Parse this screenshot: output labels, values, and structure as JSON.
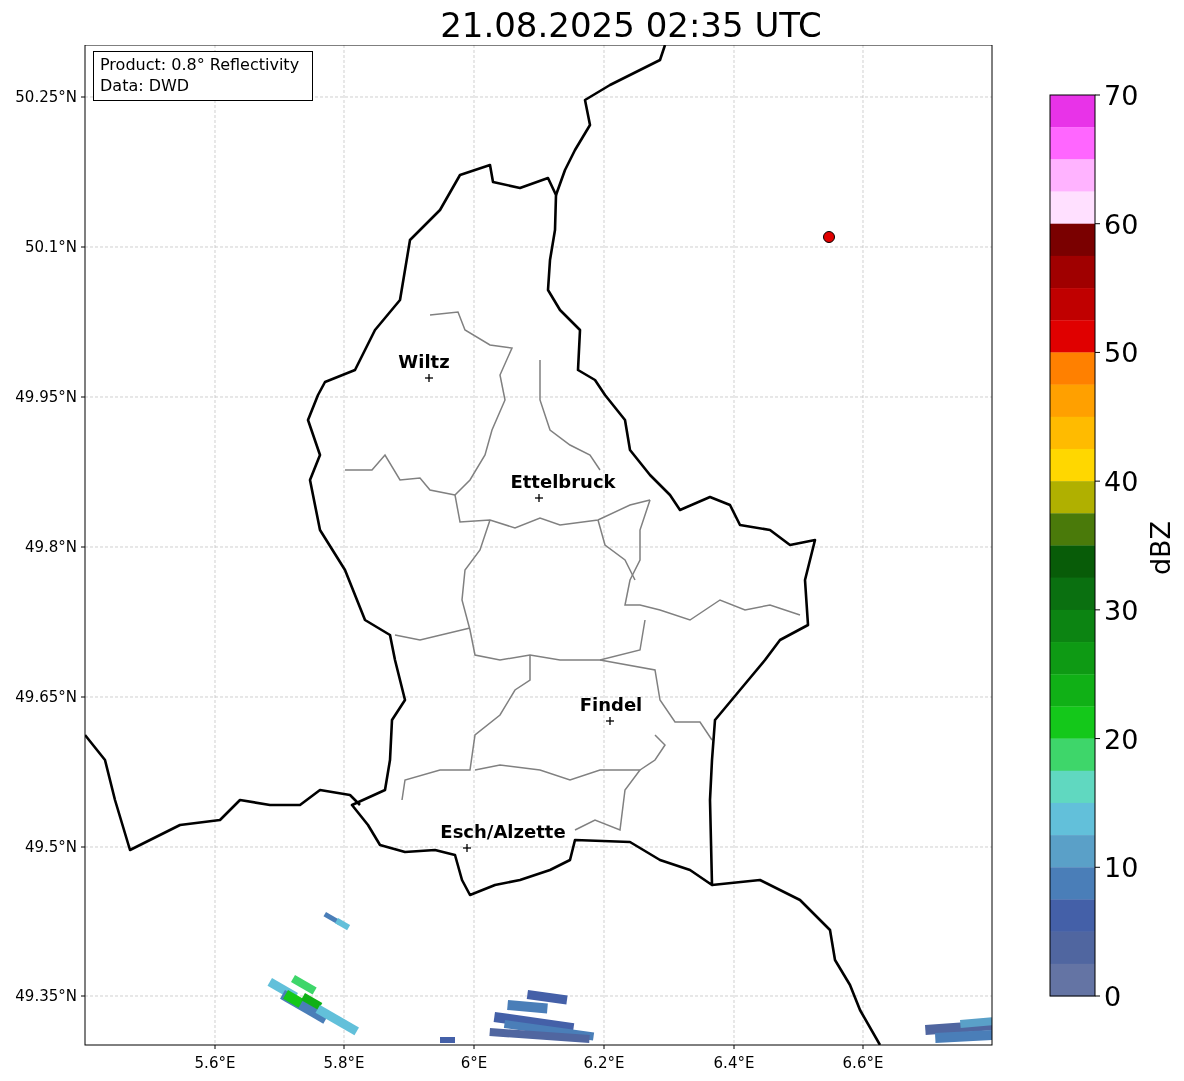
{
  "title": "21.08.2025 02:35 UTC",
  "info_box": {
    "lines": [
      "Product: 0.8° Reflectivity",
      "Data: DWD"
    ]
  },
  "map": {
    "cities": [
      {
        "name": "Wiltz"
      },
      {
        "name": "Ettelbruck"
      },
      {
        "name": "Findel"
      },
      {
        "name": "Esch/Alzette"
      }
    ],
    "lat_ticks": [
      "50.25°N",
      "50.1°N",
      "49.95°N",
      "49.8°N",
      "49.65°N",
      "49.5°N",
      "49.35°N"
    ],
    "lon_ticks": [
      "5.6°E",
      "5.8°E",
      "6°E",
      "6.2°E",
      "6.4°E",
      "6.6°E"
    ]
  },
  "colorbar": {
    "label": "dBZ",
    "ticks": [
      "70",
      "60",
      "50",
      "40",
      "30",
      "20",
      "10",
      "0"
    ],
    "bins": [
      {
        "color": "#e833e8"
      },
      {
        "color": "#ff66ff"
      },
      {
        "color": "#ffb3ff"
      },
      {
        "color": "#ffe0ff"
      },
      {
        "color": "#7a0000"
      },
      {
        "color": "#a00000"
      },
      {
        "color": "#c00000"
      },
      {
        "color": "#e00000"
      },
      {
        "color": "#ff8000"
      },
      {
        "color": "#ffa000"
      },
      {
        "color": "#ffbb00"
      },
      {
        "color": "#ffd700"
      },
      {
        "color": "#b0b000"
      },
      {
        "color": "#4a7a0a"
      },
      {
        "color": "#085c08"
      },
      {
        "color": "#0a7010"
      },
      {
        "color": "#0c8412"
      },
      {
        "color": "#0e9a14"
      },
      {
        "color": "#10b016"
      },
      {
        "color": "#14c81a"
      },
      {
        "color": "#3ed66a"
      },
      {
        "color": "#60d8c0"
      },
      {
        "color": "#62c0da"
      },
      {
        "color": "#5aa0c8"
      },
      {
        "color": "#4a7eb8"
      },
      {
        "color": "#4460a8"
      },
      {
        "color": "#5066a0"
      },
      {
        "color": "#6474a4"
      }
    ]
  }
}
